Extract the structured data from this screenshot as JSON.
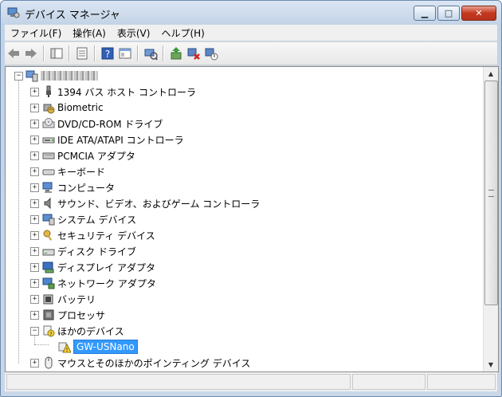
{
  "window": {
    "title": "デバイス マネージャ",
    "controls": [
      "minimize",
      "maximize",
      "close"
    ]
  },
  "menu": [
    {
      "label": "ファイル(F)"
    },
    {
      "label": "操作(A)"
    },
    {
      "label": "表示(V)"
    },
    {
      "label": "ヘルプ(H)"
    }
  ],
  "toolbar_icons": [
    "back-icon",
    "forward-icon",
    "console-tree-icon",
    "properties-icon",
    "help-icon",
    "view-icon",
    "scan-hardware-icon",
    "update-driver-icon",
    "uninstall-icon",
    "disable-icon"
  ],
  "tree": {
    "root_label": "",
    "root_label_note": "blurred",
    "items": [
      {
        "label": "1394 バス ホスト コントローラ",
        "icon": "usb-plug-icon"
      },
      {
        "label": "Biometric",
        "icon": "biometric-icon"
      },
      {
        "label": "DVD/CD-ROM ドライブ",
        "icon": "dvd-drive-icon"
      },
      {
        "label": "IDE ATA/ATAPI コントローラ",
        "icon": "ide-controller-icon"
      },
      {
        "label": "PCMCIA アダプタ",
        "icon": "pcmcia-icon"
      },
      {
        "label": "キーボード",
        "icon": "keyboard-icon"
      },
      {
        "label": "コンピュータ",
        "icon": "computer-icon"
      },
      {
        "label": "サウンド、ビデオ、およびゲーム コントローラ",
        "icon": "speaker-icon"
      },
      {
        "label": "システム デバイス",
        "icon": "system-device-icon"
      },
      {
        "label": "セキュリティ デバイス",
        "icon": "security-key-icon"
      },
      {
        "label": "ディスク ドライブ",
        "icon": "disk-drive-icon"
      },
      {
        "label": "ディスプレイ アダプタ",
        "icon": "display-adapter-icon"
      },
      {
        "label": "ネットワーク アダプタ",
        "icon": "network-adapter-icon"
      },
      {
        "label": "バッテリ",
        "icon": "battery-icon"
      },
      {
        "label": "プロセッサ",
        "icon": "processor-icon"
      },
      {
        "label": "ほかのデバイス",
        "icon": "unknown-device-icon",
        "expanded": true,
        "children": [
          {
            "label": "GW-USNano",
            "icon": "warning-device-icon",
            "selected": true
          }
        ]
      },
      {
        "label": "マウスとそのほかのポインティング デバイス",
        "icon": "mouse-icon"
      }
    ]
  },
  "colors": {
    "selection": "#3399ff",
    "title_bg": "#c9d7e8",
    "close_button": "#c4391e"
  }
}
